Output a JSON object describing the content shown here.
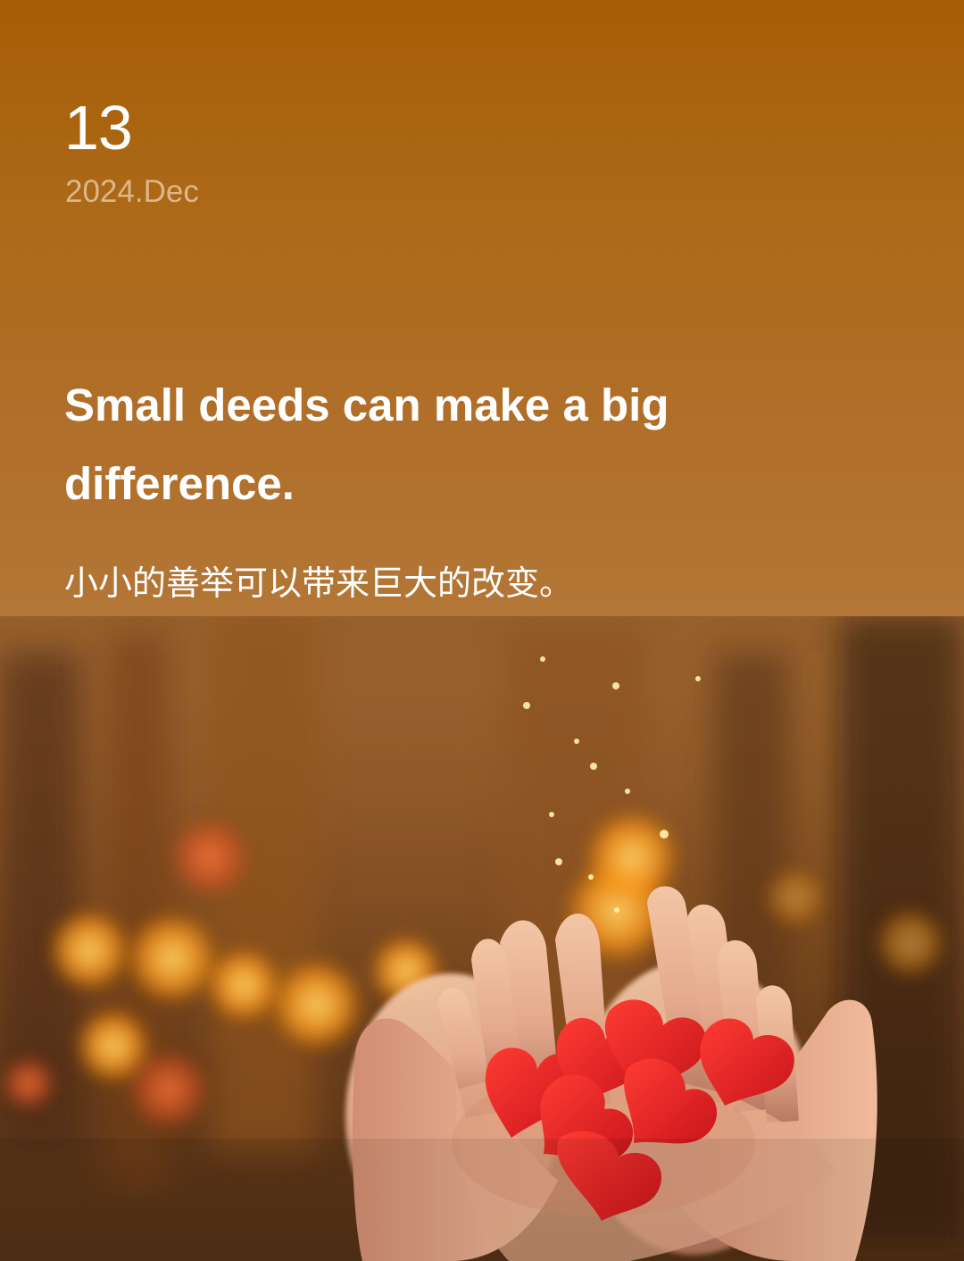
{
  "date": {
    "day": "13",
    "month": "2024.Dec"
  },
  "quote": {
    "english": "Small deeds can make a big difference.",
    "chinese": "小小的善举可以带来巨大的改变。"
  },
  "image": {
    "subject": "cupped-hands-with-red-paper-hearts",
    "accent_color": "#a65e05",
    "highlight_color": "#ffb12f",
    "heart_color": "#e41f22"
  }
}
